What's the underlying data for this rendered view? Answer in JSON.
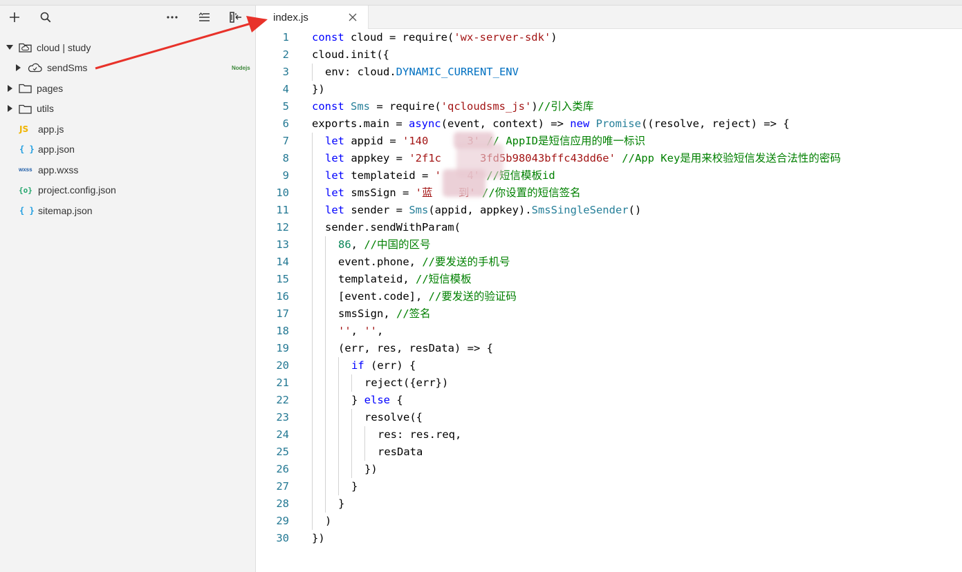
{
  "sidebar": {
    "tree": [
      {
        "label": "cloud | study",
        "expanded": true,
        "type": "cloud-folder",
        "depth": 0
      },
      {
        "label": "sendSms",
        "expanded": false,
        "type": "cloud-function",
        "depth": 1,
        "badge": "Nodejs"
      },
      {
        "label": "pages",
        "expanded": false,
        "type": "folder",
        "depth": 0
      },
      {
        "label": "utils",
        "expanded": false,
        "type": "folder",
        "depth": 0
      },
      {
        "label": "app.js",
        "type": "file",
        "icon": "JS",
        "depth": 0
      },
      {
        "label": "app.json",
        "type": "file",
        "icon": "{ }",
        "depth": 0
      },
      {
        "label": "app.wxss",
        "type": "file",
        "icon": "wxss",
        "depth": 0
      },
      {
        "label": "project.config.json",
        "type": "file",
        "icon": "{o}",
        "depth": 0
      },
      {
        "label": "sitemap.json",
        "type": "file",
        "icon": "{ }",
        "depth": 0
      }
    ]
  },
  "tabs": [
    {
      "label": "index.js",
      "active": true
    }
  ],
  "colors": {
    "keyword": "#0000ff",
    "string": "#a31515",
    "comment": "#008000",
    "type": "#267f99",
    "constant": "#0070c1",
    "number": "#098658",
    "line_number": "#237893",
    "annotation_arrow": "#e8322a"
  },
  "editor": {
    "lines": [
      {
        "indent": 0,
        "tokens": [
          {
            "t": "kw",
            "v": "const"
          },
          {
            "t": "pl",
            "v": " cloud = require("
          },
          {
            "t": "str",
            "v": "'wx-server-sdk'"
          },
          {
            "t": "pl",
            "v": ")"
          }
        ]
      },
      {
        "indent": 0,
        "tokens": [
          {
            "t": "pl",
            "v": "cloud.init({"
          }
        ]
      },
      {
        "indent": 1,
        "tokens": [
          {
            "t": "pl",
            "v": "env: cloud."
          },
          {
            "t": "cn",
            "v": "DYNAMIC_CURRENT_ENV"
          }
        ]
      },
      {
        "indent": 0,
        "tokens": [
          {
            "t": "pl",
            "v": "})"
          }
        ]
      },
      {
        "indent": 0,
        "tokens": [
          {
            "t": "kw",
            "v": "const"
          },
          {
            "t": "pl",
            "v": " "
          },
          {
            "t": "ty",
            "v": "Sms"
          },
          {
            "t": "pl",
            "v": " = require("
          },
          {
            "t": "str",
            "v": "'qcloudsms_js'"
          },
          {
            "t": "pl",
            "v": ")"
          },
          {
            "t": "cm",
            "v": "//引入类库"
          }
        ]
      },
      {
        "indent": 0,
        "tokens": [
          {
            "t": "pl",
            "v": "exports.main = "
          },
          {
            "t": "kw",
            "v": "async"
          },
          {
            "t": "pl",
            "v": "(event, context) => "
          },
          {
            "t": "kw",
            "v": "new"
          },
          {
            "t": "pl",
            "v": " "
          },
          {
            "t": "ty",
            "v": "Promise"
          },
          {
            "t": "pl",
            "v": "((resolve, reject) => {"
          }
        ]
      },
      {
        "indent": 1,
        "tokens": [
          {
            "t": "kw",
            "v": "let"
          },
          {
            "t": "pl",
            "v": " appid = "
          },
          {
            "t": "str",
            "v": "'140      3'"
          },
          {
            "t": "pl",
            "v": " "
          },
          {
            "t": "cm",
            "v": "// AppID是短信应用的唯一标识"
          }
        ]
      },
      {
        "indent": 1,
        "tokens": [
          {
            "t": "kw",
            "v": "let"
          },
          {
            "t": "pl",
            "v": " appkey = "
          },
          {
            "t": "str",
            "v": "'2f1c      3fd5b98043bffc43dd6e'"
          },
          {
            "t": "pl",
            "v": " "
          },
          {
            "t": "cm",
            "v": "//App Key是用来校验短信发送合法性的密码"
          }
        ]
      },
      {
        "indent": 1,
        "tokens": [
          {
            "t": "kw",
            "v": "let"
          },
          {
            "t": "pl",
            "v": " templateid = "
          },
          {
            "t": "str",
            "v": "'    4'"
          },
          {
            "t": "pl",
            "v": " "
          },
          {
            "t": "cm",
            "v": "//短信模板id"
          }
        ]
      },
      {
        "indent": 1,
        "tokens": [
          {
            "t": "kw",
            "v": "let"
          },
          {
            "t": "pl",
            "v": " smsSign = "
          },
          {
            "t": "str",
            "v": "'蓝    到'"
          },
          {
            "t": "pl",
            "v": " "
          },
          {
            "t": "cm",
            "v": "//你设置的短信签名"
          }
        ]
      },
      {
        "indent": 1,
        "tokens": [
          {
            "t": "kw",
            "v": "let"
          },
          {
            "t": "pl",
            "v": " sender = "
          },
          {
            "t": "ty",
            "v": "Sms"
          },
          {
            "t": "pl",
            "v": "(appid, appkey)."
          },
          {
            "t": "ty",
            "v": "SmsSingleSender"
          },
          {
            "t": "pl",
            "v": "()"
          }
        ]
      },
      {
        "indent": 1,
        "tokens": [
          {
            "t": "pl",
            "v": "sender.sendWithParam("
          }
        ]
      },
      {
        "indent": 2,
        "tokens": [
          {
            "t": "nm",
            "v": "86"
          },
          {
            "t": "pl",
            "v": ", "
          },
          {
            "t": "cm",
            "v": "//中国的区号"
          }
        ]
      },
      {
        "indent": 2,
        "tokens": [
          {
            "t": "pl",
            "v": "event.phone, "
          },
          {
            "t": "cm",
            "v": "//要发送的手机号"
          }
        ]
      },
      {
        "indent": 2,
        "tokens": [
          {
            "t": "pl",
            "v": "templateid, "
          },
          {
            "t": "cm",
            "v": "//短信模板"
          }
        ]
      },
      {
        "indent": 2,
        "tokens": [
          {
            "t": "pl",
            "v": "[event.code], "
          },
          {
            "t": "cm",
            "v": "//要发送的验证码"
          }
        ]
      },
      {
        "indent": 2,
        "tokens": [
          {
            "t": "pl",
            "v": "smsSign, "
          },
          {
            "t": "cm",
            "v": "//签名"
          }
        ]
      },
      {
        "indent": 2,
        "tokens": [
          {
            "t": "str",
            "v": "''"
          },
          {
            "t": "pl",
            "v": ", "
          },
          {
            "t": "str",
            "v": "''"
          },
          {
            "t": "pl",
            "v": ","
          }
        ]
      },
      {
        "indent": 2,
        "tokens": [
          {
            "t": "pl",
            "v": "(err, res, resData) => {"
          }
        ]
      },
      {
        "indent": 3,
        "tokens": [
          {
            "t": "kw",
            "v": "if"
          },
          {
            "t": "pl",
            "v": " (err) {"
          }
        ]
      },
      {
        "indent": 4,
        "tokens": [
          {
            "t": "pl",
            "v": "reject({err})"
          }
        ]
      },
      {
        "indent": 3,
        "tokens": [
          {
            "t": "pl",
            "v": "} "
          },
          {
            "t": "kw",
            "v": "else"
          },
          {
            "t": "pl",
            "v": " {"
          }
        ]
      },
      {
        "indent": 4,
        "tokens": [
          {
            "t": "pl",
            "v": "resolve({"
          }
        ]
      },
      {
        "indent": 5,
        "tokens": [
          {
            "t": "pl",
            "v": "res: res.req,"
          }
        ]
      },
      {
        "indent": 5,
        "tokens": [
          {
            "t": "pl",
            "v": "resData"
          }
        ]
      },
      {
        "indent": 4,
        "tokens": [
          {
            "t": "pl",
            "v": "})"
          }
        ]
      },
      {
        "indent": 3,
        "tokens": [
          {
            "t": "pl",
            "v": "}"
          }
        ]
      },
      {
        "indent": 2,
        "tokens": [
          {
            "t": "pl",
            "v": "}"
          }
        ]
      },
      {
        "indent": 1,
        "tokens": [
          {
            "t": "pl",
            "v": ")"
          }
        ]
      },
      {
        "indent": 0,
        "tokens": [
          {
            "t": "pl",
            "v": "})"
          }
        ]
      }
    ]
  }
}
